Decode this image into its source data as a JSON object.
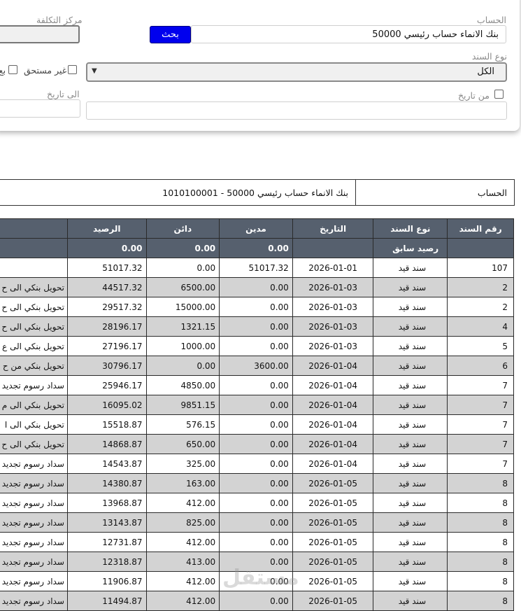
{
  "filters": {
    "account_label": "الحساب",
    "account_value": "بنك الانماء حساب رئيسي 50000",
    "search_label": "بحث",
    "cost_center_label": "مركز التكلفة",
    "voucher_type_label": "نوع السند",
    "voucher_type_value": "الكل",
    "not_due_label": "غير مستحق",
    "cut_label": "بع",
    "from_date_label": "من تاريخ",
    "to_date_label": "الى تاريخ"
  },
  "account_info": {
    "label": "الحساب",
    "value": "1010100001 - بنك الانماء حساب رئيسي 50000"
  },
  "table": {
    "headers": {
      "voucher_no": "رقم السند",
      "voucher_type": "نوع السند",
      "date": "التاريخ",
      "debit": "مدين",
      "credit": "دائن",
      "balance": "الرصيد"
    },
    "previous_balance": {
      "label": "رصيد سابق",
      "debit": "0.00",
      "credit": "0.00",
      "balance": "0.00"
    },
    "rows": [
      {
        "desc": "",
        "balance": "51017.32",
        "credit": "0.00",
        "debit": "51017.32",
        "date": "2026-01-01",
        "type": "سند قيد",
        "no": "107"
      },
      {
        "desc": "تحويل بنكي الى ح",
        "balance": "44517.32",
        "credit": "6500.00",
        "debit": "0.00",
        "date": "2026-01-03",
        "type": "سند قيد",
        "no": "2"
      },
      {
        "desc": "تحويل بنكي الى ح",
        "balance": "29517.32",
        "credit": "15000.00",
        "debit": "0.00",
        "date": "2026-01-03",
        "type": "سند قيد",
        "no": "2"
      },
      {
        "desc": "تحويل بنكي الى ح",
        "balance": "28196.17",
        "credit": "1321.15",
        "debit": "0.00",
        "date": "2026-01-03",
        "type": "سند قيد",
        "no": "4"
      },
      {
        "desc": "تحويل بنكي الى ع",
        "balance": "27196.17",
        "credit": "1000.00",
        "debit": "0.00",
        "date": "2026-01-03",
        "type": "سند قيد",
        "no": "5"
      },
      {
        "desc": "تحويل بنكي من ح",
        "balance": "30796.17",
        "credit": "0.00",
        "debit": "3600.00",
        "date": "2026-01-04",
        "type": "سند قيد",
        "no": "6"
      },
      {
        "desc": "سداد رسوم تجديد",
        "balance": "25946.17",
        "credit": "4850.00",
        "debit": "0.00",
        "date": "2026-01-04",
        "type": "سند قيد",
        "no": "7"
      },
      {
        "desc": "تحويل بنكي الى م",
        "balance": "16095.02",
        "credit": "9851.15",
        "debit": "0.00",
        "date": "2026-01-04",
        "type": "سند قيد",
        "no": "7"
      },
      {
        "desc": "تحويل بنكي الى ا",
        "balance": "15518.87",
        "credit": "576.15",
        "debit": "0.00",
        "date": "2026-01-04",
        "type": "سند قيد",
        "no": "7"
      },
      {
        "desc": "تحويل بنكي الى ح",
        "balance": "14868.87",
        "credit": "650.00",
        "debit": "0.00",
        "date": "2026-01-04",
        "type": "سند قيد",
        "no": "7"
      },
      {
        "desc": "سداد رسوم تجديد",
        "balance": "14543.87",
        "credit": "325.00",
        "debit": "0.00",
        "date": "2026-01-04",
        "type": "سند قيد",
        "no": "7"
      },
      {
        "desc": "سداد رسوم تجديد",
        "balance": "14380.87",
        "credit": "163.00",
        "debit": "0.00",
        "date": "2026-01-05",
        "type": "سند قيد",
        "no": "8"
      },
      {
        "desc": "سداد رسوم تجديد",
        "balance": "13968.87",
        "credit": "412.00",
        "debit": "0.00",
        "date": "2026-01-05",
        "type": "سند قيد",
        "no": "8"
      },
      {
        "desc": "سداد رسوم تجديد",
        "balance": "13143.87",
        "credit": "825.00",
        "debit": "0.00",
        "date": "2026-01-05",
        "type": "سند قيد",
        "no": "8"
      },
      {
        "desc": "سداد رسوم تجديد",
        "balance": "12731.87",
        "credit": "412.00",
        "debit": "0.00",
        "date": "2026-01-05",
        "type": "سند قيد",
        "no": "8"
      },
      {
        "desc": "سداد رسوم تجديد",
        "balance": "12318.87",
        "credit": "413.00",
        "debit": "0.00",
        "date": "2026-01-05",
        "type": "سند قيد",
        "no": "8"
      },
      {
        "desc": "سداد رسوم تجديد",
        "balance": "11906.87",
        "credit": "412.00",
        "debit": "0.00",
        "date": "2026-01-05",
        "type": "سند قيد",
        "no": "8"
      },
      {
        "desc": "سداد رسوم تجديد",
        "balance": "11494.87",
        "credit": "412.00",
        "debit": "0.00",
        "date": "2026-01-05",
        "type": "سند قيد",
        "no": "8"
      }
    ]
  },
  "watermark": "مستقل",
  "icons": {
    "select_arrow": "chevron-down-icon"
  },
  "colors": {
    "header_bg": "#56606e",
    "alt_row_bg": "#d3d3d3",
    "search_button": "#0000ee"
  }
}
